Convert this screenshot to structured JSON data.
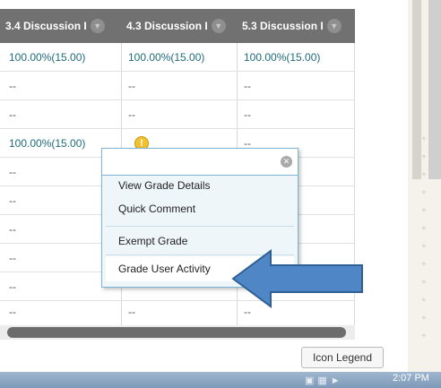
{
  "grid": {
    "columns": [
      {
        "label": "3.4 Discussion I"
      },
      {
        "label": "4.3 Discussion I"
      },
      {
        "label": "5.3 Discussion I"
      }
    ],
    "rows": [
      [
        "100.00%(15.00)",
        "100.00%(15.00)",
        "100.00%(15.00)"
      ],
      [
        "--",
        "--",
        "--"
      ],
      [
        "--",
        "--",
        "--"
      ],
      [
        "100.00%(15.00)",
        "!",
        "--"
      ],
      [
        "--",
        "",
        ""
      ],
      [
        "--",
        "",
        ""
      ],
      [
        "--",
        "",
        ""
      ],
      [
        "--",
        "",
        ""
      ],
      [
        "--",
        "",
        ""
      ],
      [
        "--",
        "--",
        "--"
      ]
    ]
  },
  "context_menu": {
    "items": [
      "View Grade Details",
      "Quick Comment",
      "Exempt Grade",
      "Grade User Activity"
    ],
    "highlighted": "Grade User Activity"
  },
  "footer": {
    "icon_legend_label": "Icon Legend"
  },
  "taskbar": {
    "clock": "2:07 PM"
  },
  "icons": {
    "header_chevron": "chevron-down-icon",
    "warning": "exclamation-icon",
    "menu_close": "close-icon",
    "pointer_arrow": "arrow-left-icon"
  },
  "colors": {
    "header_bg": "#717171",
    "grade_text": "#1e6b7a",
    "menu_border": "#7eb4d4",
    "arrow_fill": "#4f87c6"
  }
}
